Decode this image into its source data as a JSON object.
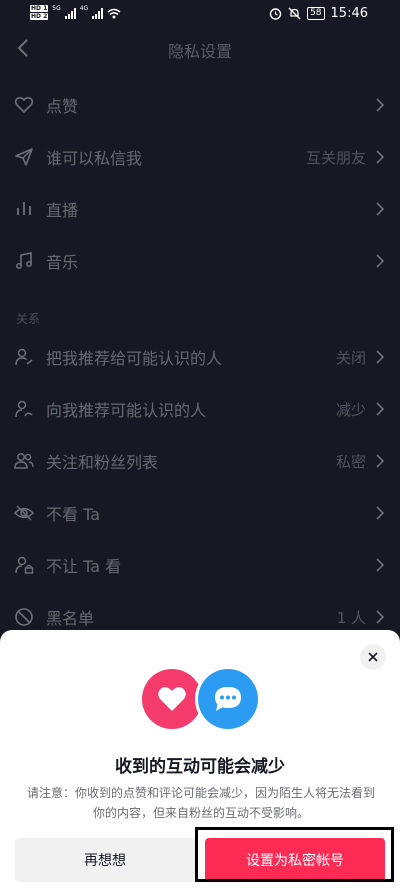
{
  "status_bar": {
    "hd1": "HD 1",
    "hd2": "HD 2",
    "net1": "5G",
    "net2": "4G",
    "battery": "58",
    "time": "15:46"
  },
  "header": {
    "title": "隐私设置"
  },
  "rows": [
    {
      "label": "点赞",
      "value": "",
      "icon": "heart-icon"
    },
    {
      "label": "谁可以私信我",
      "value": "互关朋友",
      "icon": "send-icon"
    },
    {
      "label": "直播",
      "value": "",
      "icon": "live-bars-icon"
    },
    {
      "label": "音乐",
      "value": "",
      "icon": "music-note-icon"
    }
  ],
  "relations_section": {
    "title": "关系",
    "rows": [
      {
        "label": "把我推荐给可能认识的人",
        "value": "关闭",
        "icon": "recommend-me-icon"
      },
      {
        "label": "向我推荐可能认识的人",
        "value": "减少",
        "icon": "recommend-to-me-icon"
      },
      {
        "label": "关注和粉丝列表",
        "value": "私密",
        "icon": "followers-icon"
      },
      {
        "label": "不看 Ta",
        "value": "",
        "icon": "eye-off-icon"
      },
      {
        "label": "不让 Ta 看",
        "value": "",
        "icon": "user-lock-icon"
      },
      {
        "label": "黑名单",
        "value": "1 人",
        "icon": "block-icon"
      }
    ]
  },
  "modal": {
    "title": "收到的互动可能会减少",
    "description": "请注意：你收到的点赞和评论可能会减少，因为陌生人将无法看到你的内容，但来自粉丝的互动不受影响。",
    "cancel_label": "再想想",
    "confirm_label": "设置为私密帐号",
    "colors": {
      "heart": "#f53b6b",
      "chat": "#2b9cf2",
      "confirm": "#fe2c55"
    }
  }
}
